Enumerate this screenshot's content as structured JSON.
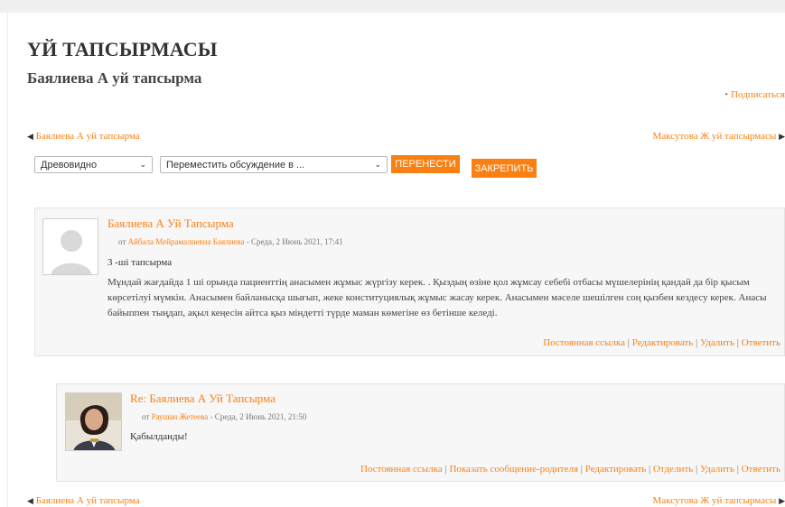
{
  "page": {
    "heading": "ҮЙ ТАПСЫРМАСЫ",
    "discussion_title": "Баялиева А уй тапсырма",
    "subscribe": "Подписаться"
  },
  "nav": {
    "prev_label": "Баялиева А уй тапсырма",
    "next_label": "Максутова Ж уй тапсырмасы"
  },
  "controls": {
    "display_mode": "Древовидно",
    "move_placeholder": "Переместить обсуждение в ...",
    "move_button": "ПЕРЕНЕСТИ",
    "pin_button": "ЗАКРЕПИТЬ"
  },
  "posts": [
    {
      "title": "Баялиева А Уй Тапсырма",
      "by": "от",
      "author": "Айбала Мейрамалиевна Баялиева",
      "date": "- Среда, 2 Июнь 2021, 17:41",
      "subject": "3 -ші тапсырма",
      "body": "Мұндай жағдайда 1 ші орында пациенттің анасымен жұмыс жүргізу керек. . Қыздың өзіне қол жұмсау себебі отбасы мүшелерінің қандай да бір қысым көрсетілуі мүмкін. Анасымен байланысқа шығып, жеке конституциялық жұмыс жасау керек. Анасымен мәселе шешілген соң қызбен кездесу керек. Анасы байыппен тыңдап, ақыл кеңесін айтса қыз міндетті түрде маман көмегіне өз бетінше келеді.",
      "commands": [
        "Постоянная ссылка",
        "Редактировать",
        "Удалить",
        "Ответить"
      ]
    },
    {
      "title": "Re: Баялиева А Уй Тапсырма",
      "by": "от",
      "author": "Раушан Жетеева",
      "date": "- Среда, 2 Июнь 2021, 21:50",
      "body": "Қабылданды!",
      "commands": [
        "Постоянная ссылка",
        "Показать сообщение-родителя",
        "Редактировать",
        "Отделить",
        "Удалить",
        "Ответить"
      ]
    }
  ],
  "colors": {
    "accent": "#f98012",
    "post_bg": "#f7f7f7"
  },
  "icons": {
    "prev": "triangle-left-icon",
    "next": "triangle-right-icon",
    "dropdown": "chevron-down-icon"
  }
}
